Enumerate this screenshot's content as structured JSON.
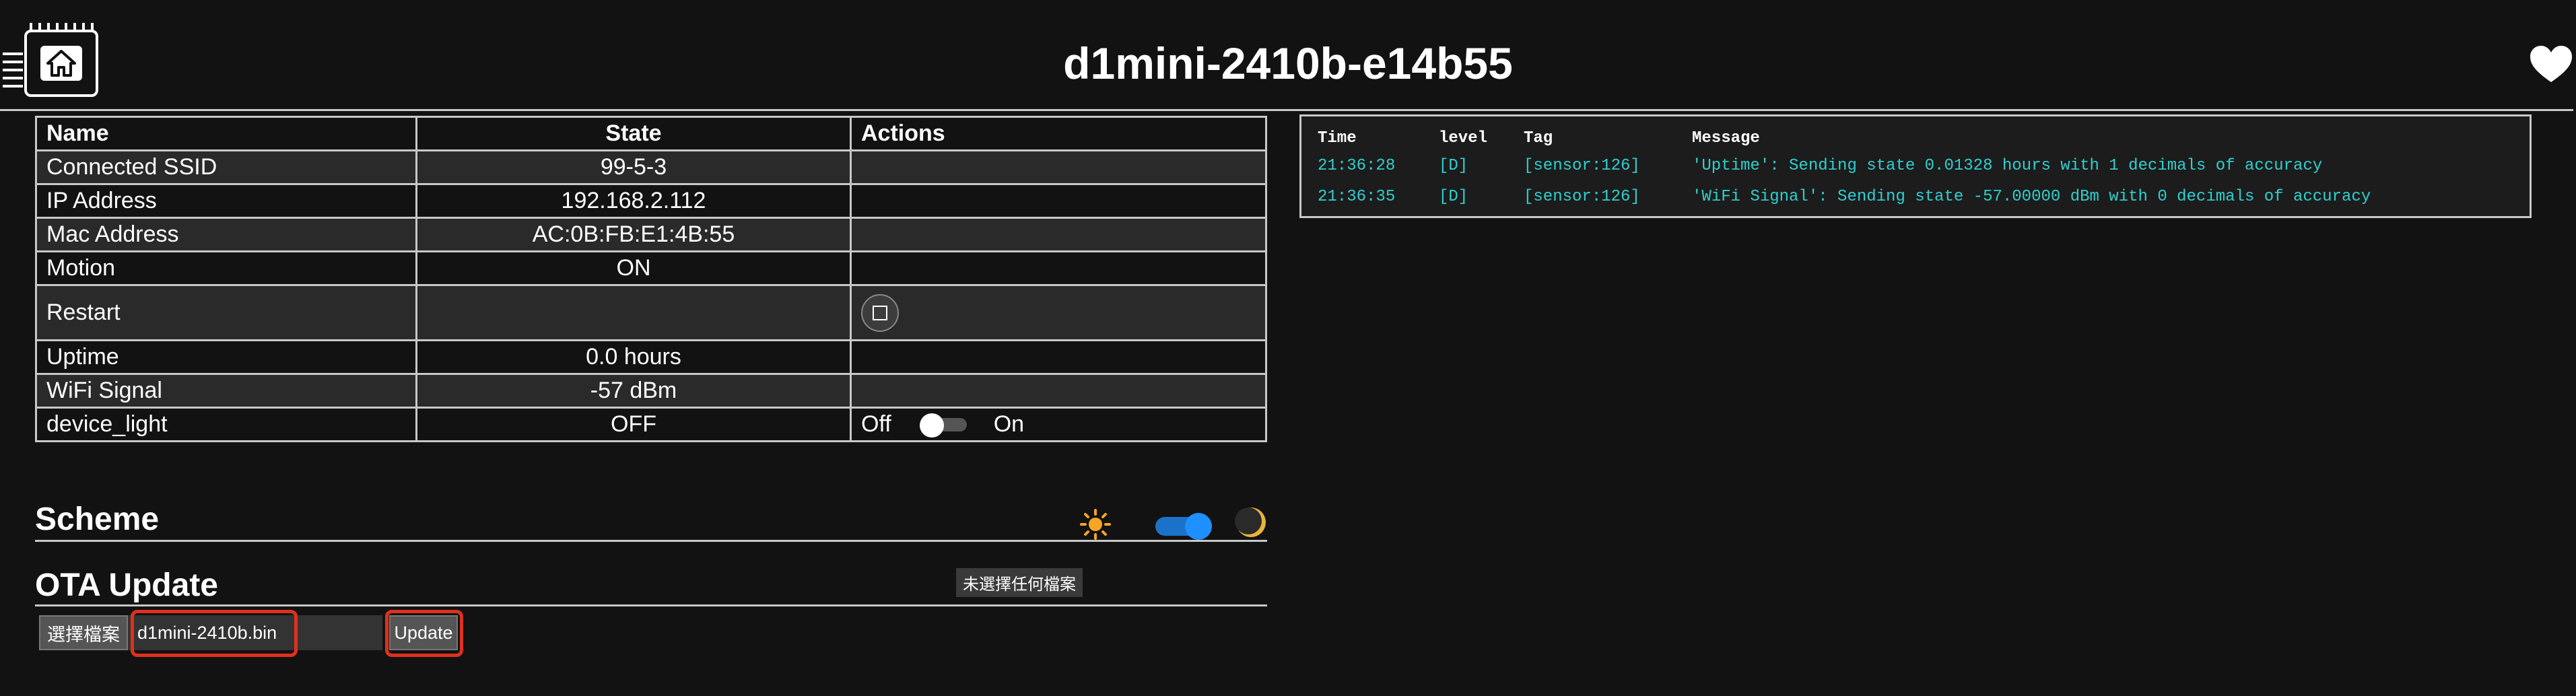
{
  "header": {
    "title": "d1mini-2410b-e14b55",
    "home_icon": "home-icon",
    "heart_icon": "heart-icon",
    "logo_icon": "chip-icon"
  },
  "entities": {
    "headers": {
      "name": "Name",
      "state": "State",
      "actions": "Actions"
    },
    "rows": [
      {
        "name": "Connected SSID",
        "state": "99-5-3"
      },
      {
        "name": "IP Address",
        "state": "192.168.2.112"
      },
      {
        "name": "Mac Address",
        "state": "AC:0B:FB:E1:4B:55"
      },
      {
        "name": "Motion",
        "state": "ON"
      },
      {
        "name": "Restart",
        "state": ""
      },
      {
        "name": "Uptime",
        "state": "0.0 hours"
      },
      {
        "name": "WiFi Signal",
        "state": "-57 dBm"
      },
      {
        "name": "device_light",
        "state": "OFF"
      }
    ],
    "light_toggle": {
      "off_label": "Off",
      "on_label": "On",
      "checked": false
    },
    "restart_icon": "stop-square-icon"
  },
  "scheme": {
    "title": "Scheme",
    "sun_icon": "sun-icon",
    "moon_icon": "moon-icon",
    "dark_mode": true
  },
  "ota": {
    "title": "OTA Update",
    "choose_file_label": "選擇檔案",
    "file_name": "d1mini-2410b.bin",
    "tooltip": "未選擇任何檔案",
    "update_label": "Update",
    "highlight_color": "#e0301e"
  },
  "log": {
    "headers": {
      "time": "Time",
      "level": "level",
      "tag": "Tag",
      "message": "Message"
    },
    "rows": [
      {
        "time": "21:36:28",
        "level": "[D]",
        "tag": "[sensor:126]",
        "message": "'Uptime': Sending state 0.01328 hours with 1 decimals of accuracy"
      },
      {
        "time": "21:36:35",
        "level": "[D]",
        "tag": "[sensor:126]",
        "message": "'WiFi Signal': Sending state -57.00000 dBm with 0 decimals of accuracy"
      }
    ],
    "text_color": "#2fd0d0"
  }
}
